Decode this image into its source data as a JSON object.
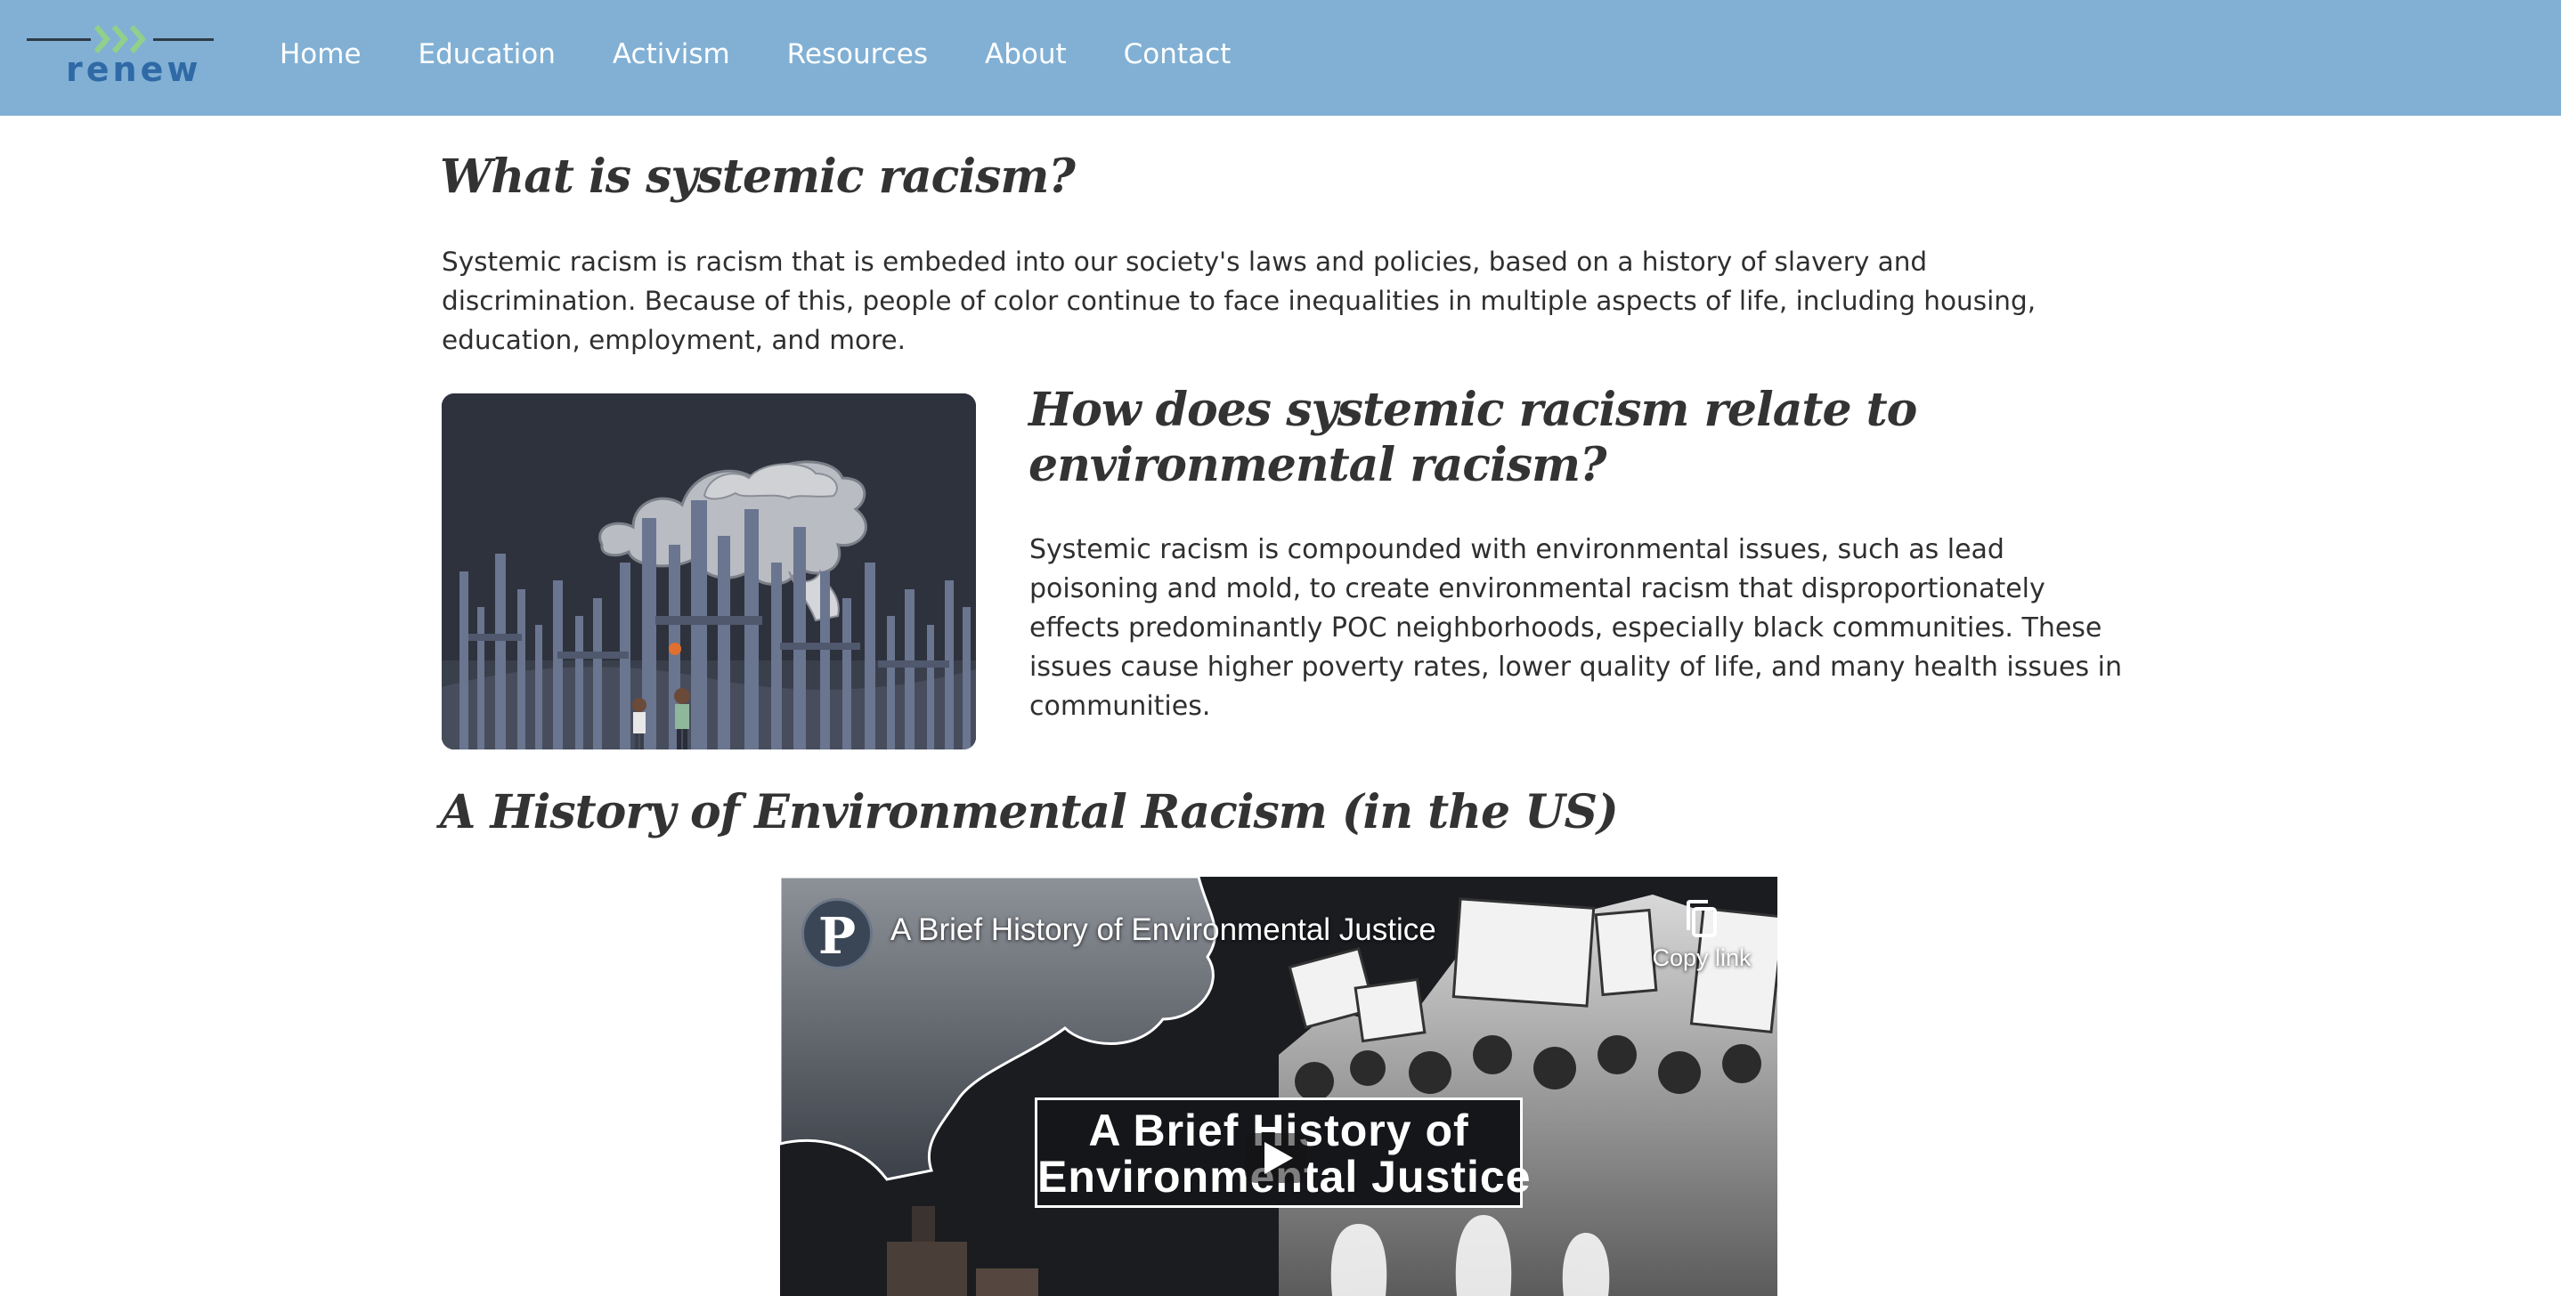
{
  "nav": {
    "logo_text": "renew",
    "items": [
      "Home",
      "Education",
      "Activism",
      "Resources",
      "About",
      "Contact"
    ]
  },
  "sections": {
    "what": {
      "heading": "What is systemic racism?",
      "text": "Systemic racism is racism that is embeded into our society's laws and policies, based on a history of slavery and discrimination. Because of this, people of color continue to face inequalities in multiple aspects of life, including housing, education, employment, and more."
    },
    "how": {
      "heading": "How does systemic racism relate to environmental racism?",
      "text": "Systemic racism is compounded with environmental issues, such as lead poisoning and mold, to create environmental racism that disproportionately effects predominantly POC neighborhoods, especially black communities. These issues cause higher poverty rates, lower quality of life, and many health issues in communities."
    },
    "history": {
      "heading": "A History of Environmental Racism (in the US)"
    }
  },
  "video": {
    "channel_initial": "P",
    "title": "A Brief History of Environmental Justice",
    "copy_label": "Copy link",
    "card_line1": "A Brief History of",
    "card_line2": "Environmental Justice"
  },
  "colors": {
    "nav_bg": "#81b0d4",
    "logo_blue": "#2f6aa6",
    "logo_green": "#8fd18a",
    "heading": "#333333"
  }
}
